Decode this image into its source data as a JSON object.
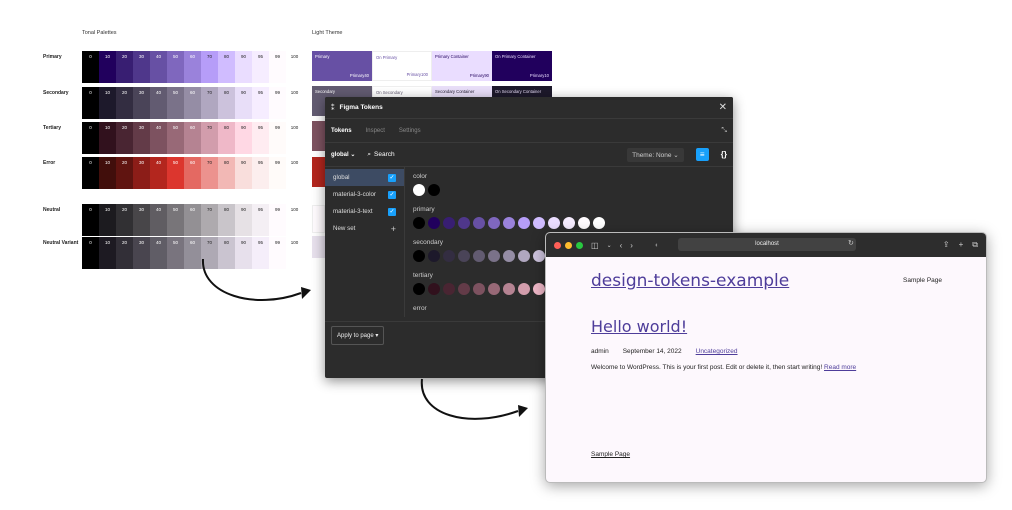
{
  "tonal": {
    "title": "Tonal Palettes",
    "tones": [
      "0",
      "10",
      "20",
      "30",
      "40",
      "50",
      "60",
      "70",
      "80",
      "90",
      "95",
      "99",
      "100"
    ],
    "rows": [
      {
        "label": "Primary",
        "colors": [
          "#000000",
          "#21005d",
          "#381e72",
          "#4f378b",
          "#6750a4",
          "#7f67be",
          "#9a82db",
          "#b69df8",
          "#d0bcff",
          "#eaddff",
          "#f6edff",
          "#fffbfe",
          "#ffffff"
        ]
      },
      {
        "label": "Secondary",
        "colors": [
          "#000000",
          "#1d192b",
          "#332d41",
          "#4a4458",
          "#625b71",
          "#7a7289",
          "#958da5",
          "#b0a7c0",
          "#ccc2dc",
          "#e8def8",
          "#f6edff",
          "#fffbfe",
          "#ffffff"
        ]
      },
      {
        "label": "Tertiary",
        "colors": [
          "#000000",
          "#31111d",
          "#492532",
          "#633b48",
          "#7d5260",
          "#986977",
          "#b58392",
          "#d29dac",
          "#efb8c8",
          "#ffd8e4",
          "#ffecf1",
          "#fffbfa",
          "#ffffff"
        ]
      },
      {
        "label": "Error",
        "colors": [
          "#000000",
          "#410e0b",
          "#601410",
          "#8c1d18",
          "#b3261e",
          "#dc362e",
          "#e46962",
          "#ec928e",
          "#f2b8b5",
          "#f9dedc",
          "#fceeee",
          "#fffbf9",
          "#ffffff"
        ]
      },
      {
        "label": "Neutral",
        "colors": [
          "#000000",
          "#1c1b1f",
          "#313033",
          "#484649",
          "#605d62",
          "#787579",
          "#939094",
          "#aeaaae",
          "#c9c5ca",
          "#e6e1e5",
          "#f4eff4",
          "#fffbfe",
          "#ffffff"
        ]
      },
      {
        "label": "Neutral Variant",
        "colors": [
          "#000000",
          "#1d1a22",
          "#322f37",
          "#49454f",
          "#605d66",
          "#79747e",
          "#938f99",
          "#aea9b4",
          "#cac4d0",
          "#e7e0ec",
          "#f5eefa",
          "#fffbfe",
          "#ffffff"
        ]
      }
    ]
  },
  "light_theme": {
    "title": "Light Theme",
    "primary_row": [
      {
        "label": "Primary",
        "num": "Primary40",
        "bg": "#6750a4",
        "fg": "#ffffff"
      },
      {
        "label": "On Primary",
        "num": "Primary100",
        "bg": "#ffffff",
        "fg": "#6750a4"
      },
      {
        "label": "Primary Container",
        "num": "Primary90",
        "bg": "#eaddff",
        "fg": "#21005d"
      },
      {
        "label": "On Primary Container",
        "num": "Primary10",
        "bg": "#21005d",
        "fg": "#eaddff"
      }
    ],
    "secondary_row": [
      {
        "label": "Secondary",
        "bg": "#625b71",
        "fg": "#ffffff"
      },
      {
        "label": "On Secondary",
        "bg": "#ffffff",
        "fg": "#625b71"
      },
      {
        "label": "Secondary Container",
        "bg": "#e8def8",
        "fg": "#1d192b"
      },
      {
        "label": "On Secondary Container",
        "bg": "#1d192b",
        "fg": "#e8def8"
      }
    ]
  },
  "figma": {
    "title": "Figma Tokens",
    "tabs": [
      "Tokens",
      "Inspect",
      "Settings"
    ],
    "active_set": "global",
    "search": "Search",
    "theme": "Theme: None",
    "sets": [
      "global",
      "material-3-color",
      "material-3-text"
    ],
    "new_set": "New set",
    "groups": {
      "color": "color",
      "primary": "primary",
      "secondary": "secondary",
      "tertiary": "tertiary",
      "error": "error"
    },
    "apply": "Apply to page"
  },
  "browser": {
    "url": "localhost",
    "site_title": "design-tokens-example",
    "nav_link": "Sample Page",
    "post_title": "Hello world!",
    "author": "admin",
    "date": "September 14, 2022",
    "category": "Uncategorized",
    "excerpt": "Welcome to WordPress. This is your first post. Edit or delete it, then start writing!",
    "read_more": "Read more",
    "footer_link": "Sample Page"
  }
}
